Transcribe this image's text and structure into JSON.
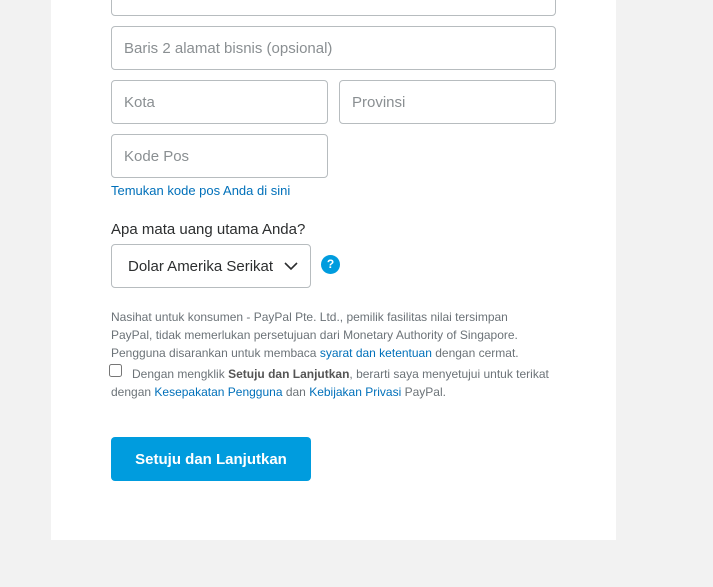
{
  "form": {
    "address_line2_placeholder": "Baris 2 alamat bisnis (opsional)",
    "city_placeholder": "Kota",
    "province_placeholder": "Provinsi",
    "postal_placeholder": "Kode Pos",
    "postal_help_link": "Temukan kode pos Anda di sini",
    "currency_question": "Apa mata uang utama Anda?",
    "currency_selected": "Dolar Amerika Serikat",
    "help_icon_symbol": "?"
  },
  "notice": {
    "text_before_link": "Nasihat untuk konsumen - PayPal Pte. Ltd., pemilik fasilitas nilai tersimpan PayPal, tidak memerlukan persetujuan dari Monetary Authority of Singapore. Pengguna disarankan untuk membaca ",
    "terms_link": "syarat dan ketentuan",
    "text_after_link": " dengan cermat."
  },
  "agreement": {
    "checked": false,
    "prefix": "Dengan mengklik ",
    "bold": "Setuju dan Lanjutkan",
    "middle": ", berarti saya menyetujui untuk terikat dengan ",
    "user_agreement_link": "Kesepakatan Pengguna",
    "connector": " dan ",
    "privacy_link": "Kebijakan Privasi",
    "suffix": " PayPal."
  },
  "submit_label": "Setuju dan Lanjutkan",
  "colors": {
    "accent": "#009cde",
    "link": "#0070ba",
    "page_bg": "#f2f2f2"
  }
}
